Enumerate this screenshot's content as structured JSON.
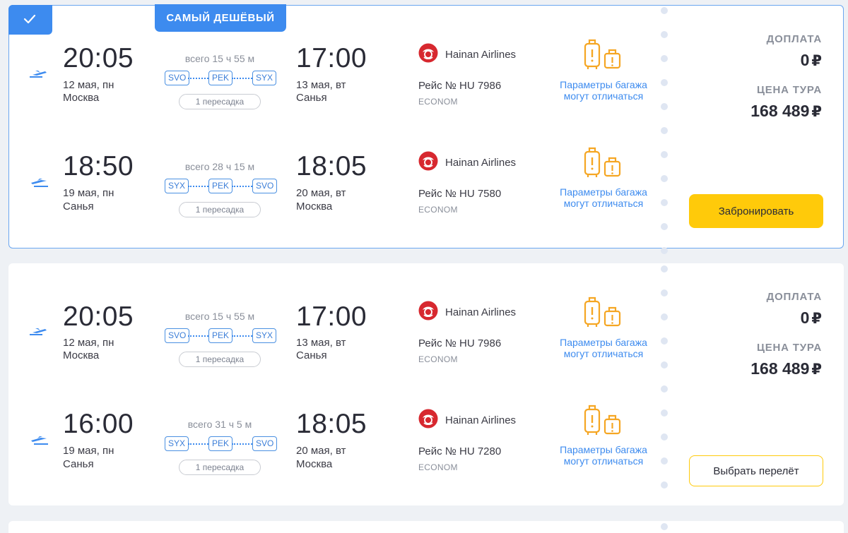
{
  "offers": [
    {
      "badge": "САМЫЙ ДЕШЁВЫЙ",
      "legs": [
        {
          "dep_time": "20:05",
          "dep_date": "12 мая, пн",
          "dep_city": "Москва",
          "duration": "всего 15 ч 55 м",
          "airports": [
            "SVO",
            "PEK",
            "SYX"
          ],
          "stops": "1 пересадка",
          "arr_time": "17:00",
          "arr_date": "13 мая, вт",
          "arr_city": "Санья",
          "airline": "Hainan Airlines",
          "flight": "Рейс № HU 7986",
          "class": "ECONOM",
          "baggage": "Параметры багажа могут отличаться"
        },
        {
          "dep_time": "18:50",
          "dep_date": "19 мая, пн",
          "dep_city": "Санья",
          "duration": "всего 28 ч 15 м",
          "airports": [
            "SYX",
            "PEK",
            "SVO"
          ],
          "stops": "1 пересадка",
          "arr_time": "18:05",
          "arr_date": "20 мая, вт",
          "arr_city": "Москва",
          "airline": "Hainan Airlines",
          "flight": "Рейс № HU 7580",
          "class": "ECONOM",
          "baggage": "Параметры багажа могут отличаться"
        }
      ],
      "surcharge_label": "ДОПЛАТА",
      "surcharge": "0",
      "price_label": "ЦЕНА ТУРА",
      "price": "168 489",
      "currency": "₽",
      "action": "Забронировать"
    },
    {
      "legs": [
        {
          "dep_time": "20:05",
          "dep_date": "12 мая, пн",
          "dep_city": "Москва",
          "duration": "всего 15 ч 55 м",
          "airports": [
            "SVO",
            "PEK",
            "SYX"
          ],
          "stops": "1 пересадка",
          "arr_time": "17:00",
          "arr_date": "13 мая, вт",
          "arr_city": "Санья",
          "airline": "Hainan Airlines",
          "flight": "Рейс № HU 7986",
          "class": "ECONOM",
          "baggage": "Параметры багажа могут отличаться"
        },
        {
          "dep_time": "16:00",
          "dep_date": "19 мая, пн",
          "dep_city": "Санья",
          "duration": "всего 31 ч 5 м",
          "airports": [
            "SYX",
            "PEK",
            "SVO"
          ],
          "stops": "1 пересадка",
          "arr_time": "18:05",
          "arr_date": "20 мая, вт",
          "arr_city": "Москва",
          "airline": "Hainan Airlines",
          "flight": "Рейс № HU 7280",
          "class": "ECONOM",
          "baggage": "Параметры багажа могут отличаться"
        }
      ],
      "surcharge_label": "ДОПЛАТА",
      "surcharge": "0",
      "price_label": "ЦЕНА ТУРА",
      "price": "168 489",
      "currency": "₽",
      "action": "Выбрать перелёт"
    }
  ],
  "colors": {
    "accent": "#3d8bef",
    "button": "#ffca0a",
    "baggage_icon": "#f5a623",
    "airline_logo": "#d7282f"
  },
  "icons": {
    "selected": "check-icon",
    "outbound": "plane-takeoff-icon",
    "return": "plane-landing-icon",
    "baggage": "luggage-icon",
    "airline": "hainan-airlines-logo"
  }
}
